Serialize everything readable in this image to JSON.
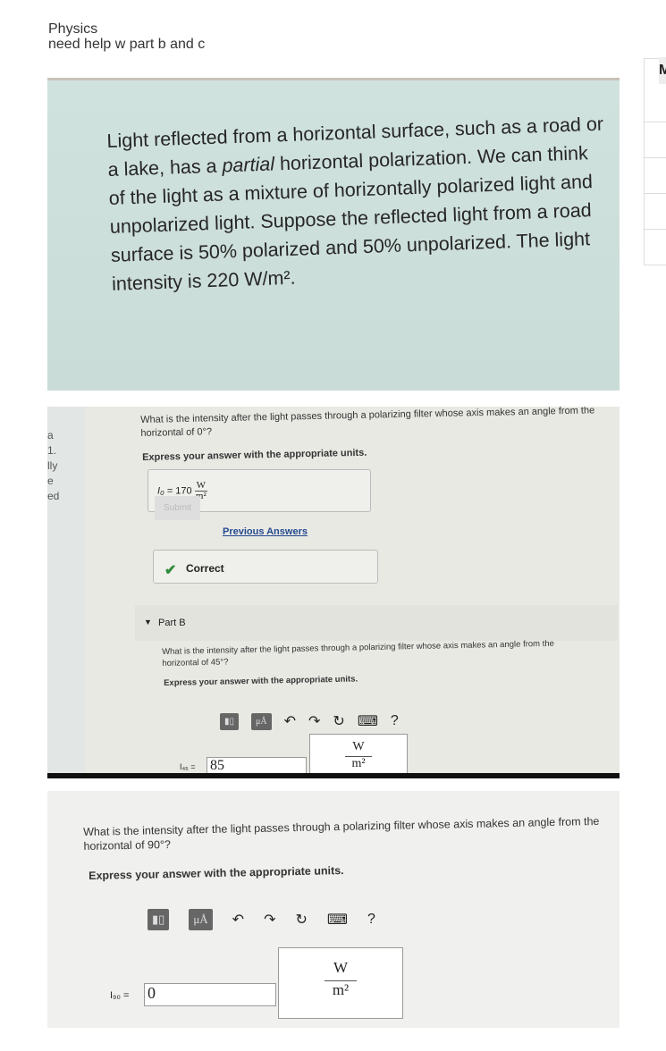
{
  "header": {
    "subject": "Physics",
    "title": "need help w part b and c"
  },
  "sidebar": {
    "letter": "M"
  },
  "intro": {
    "text_before": "Light reflected from a horizontal surface, such as a road or a lake, has a ",
    "emph": "partial",
    "text_after": " horizontal polarization. We can think of the light as a mixture of horizontally polarized light and unpolarized light. Suppose the reflected light from a road surface is 50% polarized and 50% unpolarized. The light intensity is 220 W/m².",
    "cut_text": [
      "a",
      "1.",
      "lly",
      "e",
      "ed"
    ]
  },
  "part_a": {
    "question": "What is the intensity after the light passes through a polarizing filter whose axis makes an angle from the horizontal of 0°?",
    "instruction": "Express your answer with the appropriate units.",
    "var": "I₀ =",
    "value": "170",
    "unit_num": "W",
    "unit_den": "m²",
    "submit": "Submit",
    "previous": "Previous Answers",
    "feedback": "Correct"
  },
  "part_b": {
    "label": "Part B",
    "question": "What is the intensity after the light passes through a polarizing filter whose axis makes an angle from the horizontal of 45°?",
    "instruction": "Express your answer with the appropriate units.",
    "var": "I₄₅ =",
    "value": "85",
    "unit_num": "W",
    "unit_den": "m²"
  },
  "part_c": {
    "question": "What is the intensity after the light passes through a polarizing filter whose axis makes an angle from the horizontal of 90°?",
    "instruction": "Express your answer with the appropriate units.",
    "var": "I₉₀ =",
    "value": "0",
    "unit_num": "W",
    "unit_den": "m²"
  },
  "toolbar": {
    "units": "μÅ",
    "help": "?"
  },
  "colors": {
    "correct": "#2e8b3a",
    "link": "#244a8f"
  }
}
